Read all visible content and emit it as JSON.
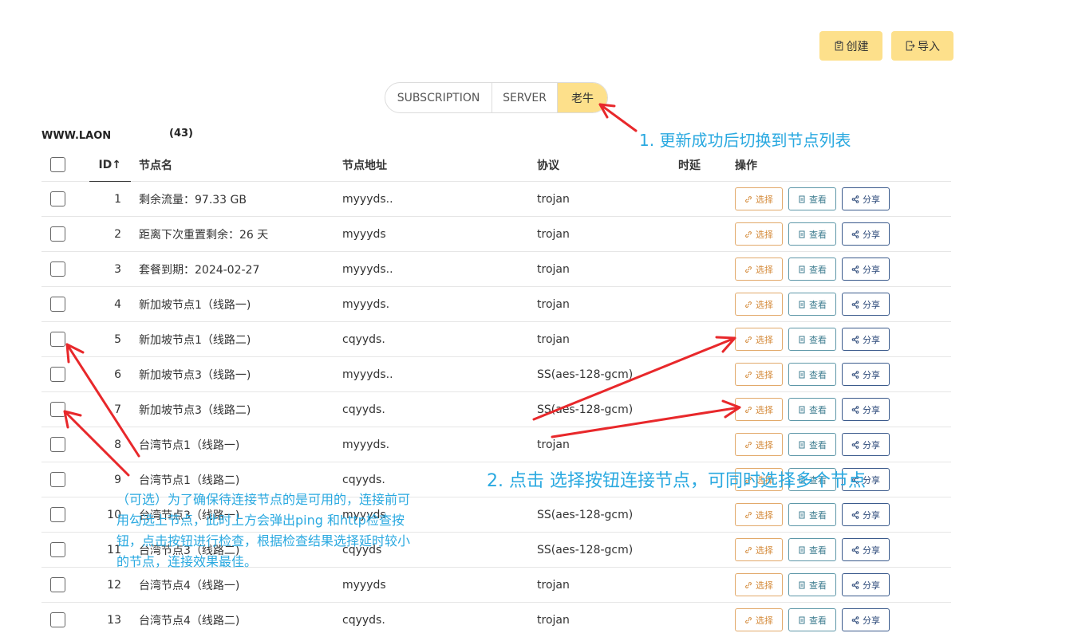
{
  "toolbar": {
    "create_label": "创建",
    "import_label": "导入"
  },
  "tabs": [
    {
      "label": "SUBSCRIPTION",
      "active": false
    },
    {
      "label": "SERVER",
      "active": false
    },
    {
      "label": "老牛",
      "active": true
    }
  ],
  "list": {
    "title": "WWW.LAONI",
    "count": "(43)"
  },
  "table": {
    "headers": {
      "id": "ID↑",
      "name": "节点名",
      "address": "节点地址",
      "protocol": "协议",
      "latency": "时延",
      "actions": "操作"
    },
    "action_labels": {
      "select": "选择",
      "view": "查看",
      "share": "分享"
    },
    "rows": [
      {
        "id": "1",
        "name": "剩余流量：97.33 GB",
        "address": "myyyds..",
        "protocol": "trojan"
      },
      {
        "id": "2",
        "name": "距离下次重置剩余：26 天",
        "address": "myyyds",
        "protocol": "trojan"
      },
      {
        "id": "3",
        "name": "套餐到期：2024-02-27",
        "address": "myyyds..",
        "protocol": "trojan"
      },
      {
        "id": "4",
        "name": "新加坡节点1（线路一)",
        "address": "myyyds.",
        "protocol": "trojan"
      },
      {
        "id": "5",
        "name": "新加坡节点1（线路二)",
        "address": "cqyyds.",
        "protocol": "trojan"
      },
      {
        "id": "6",
        "name": "新加坡节点3（线路一)",
        "address": "myyyds..",
        "protocol": "SS(aes-128-gcm)"
      },
      {
        "id": "7",
        "name": "新加坡节点3（线路二)",
        "address": "cqyyds.",
        "protocol": "SS(aes-128-gcm)"
      },
      {
        "id": "8",
        "name": "台湾节点1（线路一)",
        "address": "myyyds.",
        "protocol": "trojan"
      },
      {
        "id": "9",
        "name": "台湾节点1（线路二)",
        "address": "cqyyds.",
        "protocol": ""
      },
      {
        "id": "10",
        "name": "台湾节点3（线路一)",
        "address": "myyyds",
        "protocol": "SS(aes-128-gcm)"
      },
      {
        "id": "11",
        "name": "台湾节点3（线路二)",
        "address": "cqyyds",
        "protocol": "SS(aes-128-gcm)"
      },
      {
        "id": "12",
        "name": "台湾节点4（线路一)",
        "address": "myyyds",
        "protocol": "trojan"
      },
      {
        "id": "13",
        "name": "台湾节点4（线路二)",
        "address": "cqyyds.",
        "protocol": "trojan"
      }
    ]
  },
  "annotations": {
    "step1": "1. 更新成功后切换到节点列表",
    "step2": "2. 点击 选择按钮连接节点，可同时选择多个节点",
    "optional": "（可选）为了确保待连接节点的是可用的，连接前可用勾选上节点，此时上方会弹出ping 和http检查按钮，点击按钮进行检查，根据检查结果选择延时较小的节点，连接效果最佳。"
  },
  "colors": {
    "accent_yellow": "#fde08b",
    "select_orange": "#d48a3a",
    "view_teal": "#3f7d90",
    "share_navy": "#2d4a7a",
    "annotation_blue": "#2aa9e0",
    "arrow_red": "#e8282b"
  },
  "icons": {
    "create": "clipboard-icon",
    "import": "import-icon",
    "select": "link-icon",
    "view": "document-icon",
    "share": "share-icon"
  }
}
